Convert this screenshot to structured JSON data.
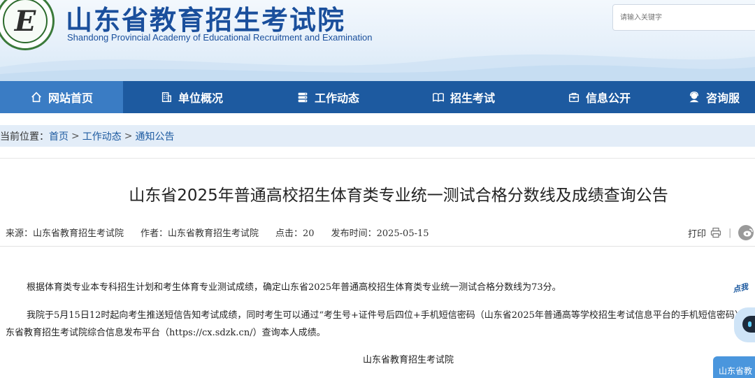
{
  "header": {
    "logo_letter": "E",
    "title": "山东省教育招生考试院",
    "subtitle": "Shandong Provincial Academy of Educational Recruitment and Examination",
    "search_placeholder": "请输入关键字"
  },
  "nav": {
    "items": [
      {
        "label": "网站首页",
        "icon": "home-icon"
      },
      {
        "label": "单位概况",
        "icon": "building-icon"
      },
      {
        "label": "工作动态",
        "icon": "server-icon"
      },
      {
        "label": "招生考试",
        "icon": "book-icon"
      },
      {
        "label": "信息公开",
        "icon": "briefcase-icon"
      },
      {
        "label": "咨询服",
        "icon": "support-icon"
      }
    ],
    "active_color": "#3a7cc4",
    "bar_color": "#1d5aa0"
  },
  "breadcrumb": {
    "prefix": "当前位置：",
    "items": [
      "首页",
      "工作动态",
      "通知公告"
    ],
    "separator": ">"
  },
  "article": {
    "title": "山东省2025年普通高校招生体育类专业统一测试合格分数线及成绩查询公告",
    "meta": {
      "source": "来源：山东省教育招生考试院",
      "author": "作者：山东省教育招生考试院",
      "clicks": "点击：20",
      "date": "发布时间：2025-05-15"
    },
    "print_label": "打印",
    "separator": "|",
    "paragraph1": "根据体育类专业本专科招生计划和考生体育专业测试成绩，确定山东省2025年普通高校招生体育类专业统一测试合格分数线为73分。",
    "paragraph2_line1": "我院于5月15日12时起向考生推送短信告知考试成绩，同时考生可以通过“考生号+证件号后四位+手机短信密码（山东省2025年普通高等学校招生考试信息平台的手机短信密码）",
    "paragraph2_line2": "东省教育招生考试院综合信息发布平台（https://cx.sdzk.cn/）查询本人成绩。",
    "signature": "山东省教育招生考试院"
  },
  "float_widget": {
    "tag": "点我",
    "button_label": "山东省教"
  }
}
